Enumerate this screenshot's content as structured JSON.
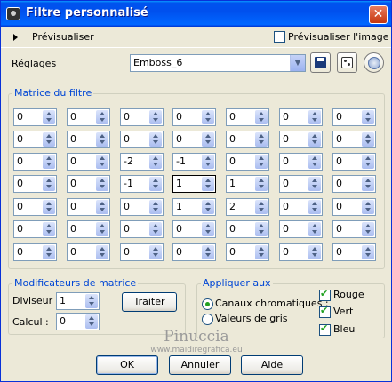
{
  "window": {
    "title": "Filtre personnalisé",
    "close_glyph": "✕"
  },
  "preview": {
    "expand_label": "Prévisualiser",
    "image_checkbox_label": "Prévisualiser l'image",
    "image_checked": false
  },
  "settings": {
    "label": "Réglages",
    "preset_value": "Emboss_6"
  },
  "matrix": {
    "title": "Matrice du filtre",
    "rows": [
      [
        "0",
        "0",
        "0",
        "0",
        "0",
        "0",
        "0"
      ],
      [
        "0",
        "0",
        "0",
        "0",
        "0",
        "0",
        "0"
      ],
      [
        "0",
        "0",
        "-2",
        "-1",
        "0",
        "0",
        "0"
      ],
      [
        "0",
        "0",
        "-1",
        "1",
        "1",
        "0",
        "0"
      ],
      [
        "0",
        "0",
        "0",
        "1",
        "2",
        "0",
        "0"
      ],
      [
        "0",
        "0",
        "0",
        "0",
        "0",
        "0",
        "0"
      ],
      [
        "0",
        "0",
        "0",
        "0",
        "0",
        "0",
        "0"
      ]
    ]
  },
  "modifiers": {
    "title": "Modificateurs de matrice",
    "divisor_label": "Diviseur :",
    "divisor_value": "1",
    "bias_label": "Calcul :",
    "bias_value": "0",
    "process_label": "Traiter"
  },
  "apply": {
    "title": "Appliquer aux",
    "chromatic_label": "Canaux chromatiques :",
    "gray_label": "Valeurs de gris",
    "red_label": "Rouge",
    "green_label": "Vert",
    "blue_label": "Bleu"
  },
  "watermark": {
    "line1": "Pinuccia",
    "line2": "www.maidiregrafica.eu"
  },
  "buttons": {
    "ok": "OK",
    "cancel": "Annuler",
    "help": "Aide"
  }
}
